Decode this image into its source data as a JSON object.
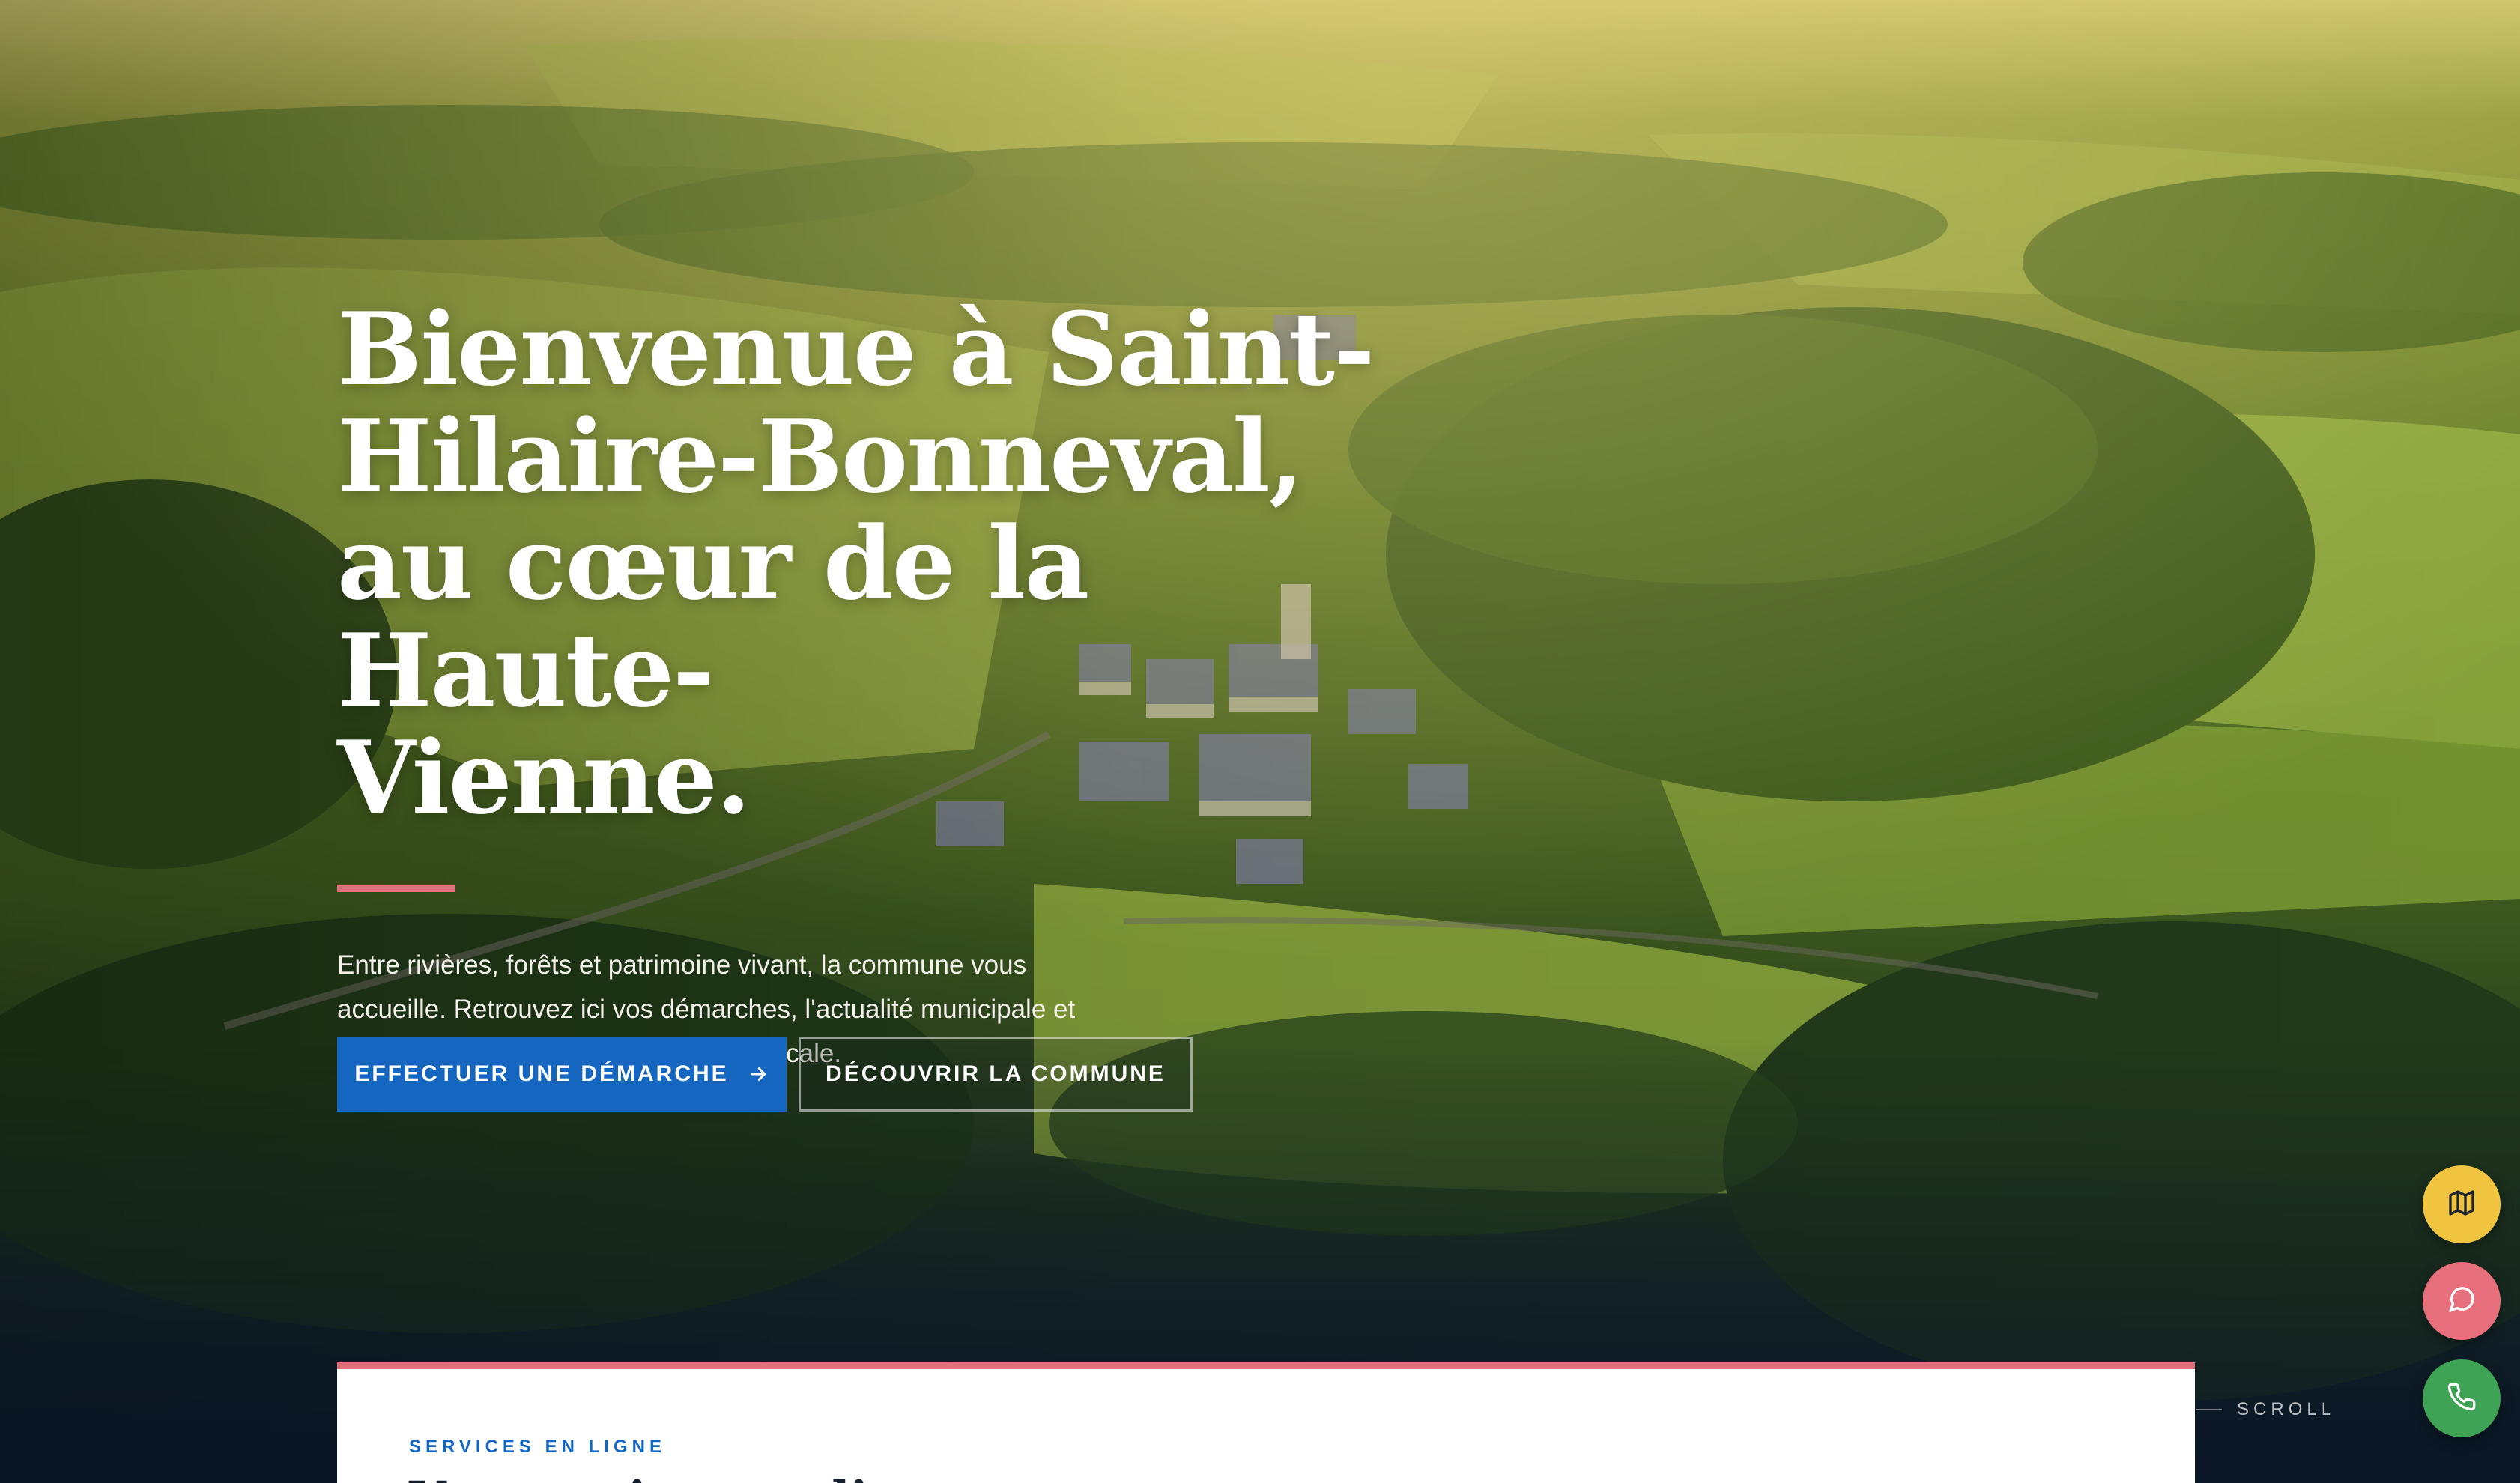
{
  "hero": {
    "title_lines": [
      "Bienvenue à Saint-",
      "Hilaire-Bonneval,",
      "au cœur de la Haute-",
      "Vienne."
    ],
    "lead_lines": [
      "Entre rivières, forêts et patrimoine vivant, la commune vous",
      "accueille. Retrouvez ici vos démarches, l'actualité municipale et",
      "toutes les informations utiles à la vie locale."
    ],
    "primary_cta": "EFFECTUER UNE DÉMARCHE",
    "secondary_cta": "DÉCOUVRIR LA COMMUNE",
    "image": "aerial-village-forest-fields"
  },
  "floating_actions": [
    {
      "icon": "map-icon",
      "color": "#f0c43e"
    },
    {
      "icon": "chat-icon",
      "color": "#e8707c"
    },
    {
      "icon": "phone-icon",
      "color": "#3ea354"
    }
  ],
  "scroll": {
    "label": "SCROLL"
  },
  "services": {
    "eyebrow": "SERVICES EN LIGNE",
    "heading": "Vos services en ligne"
  },
  "colors": {
    "accent": "#e0707c",
    "primary": "#1566c0",
    "ink": "#14202e"
  }
}
